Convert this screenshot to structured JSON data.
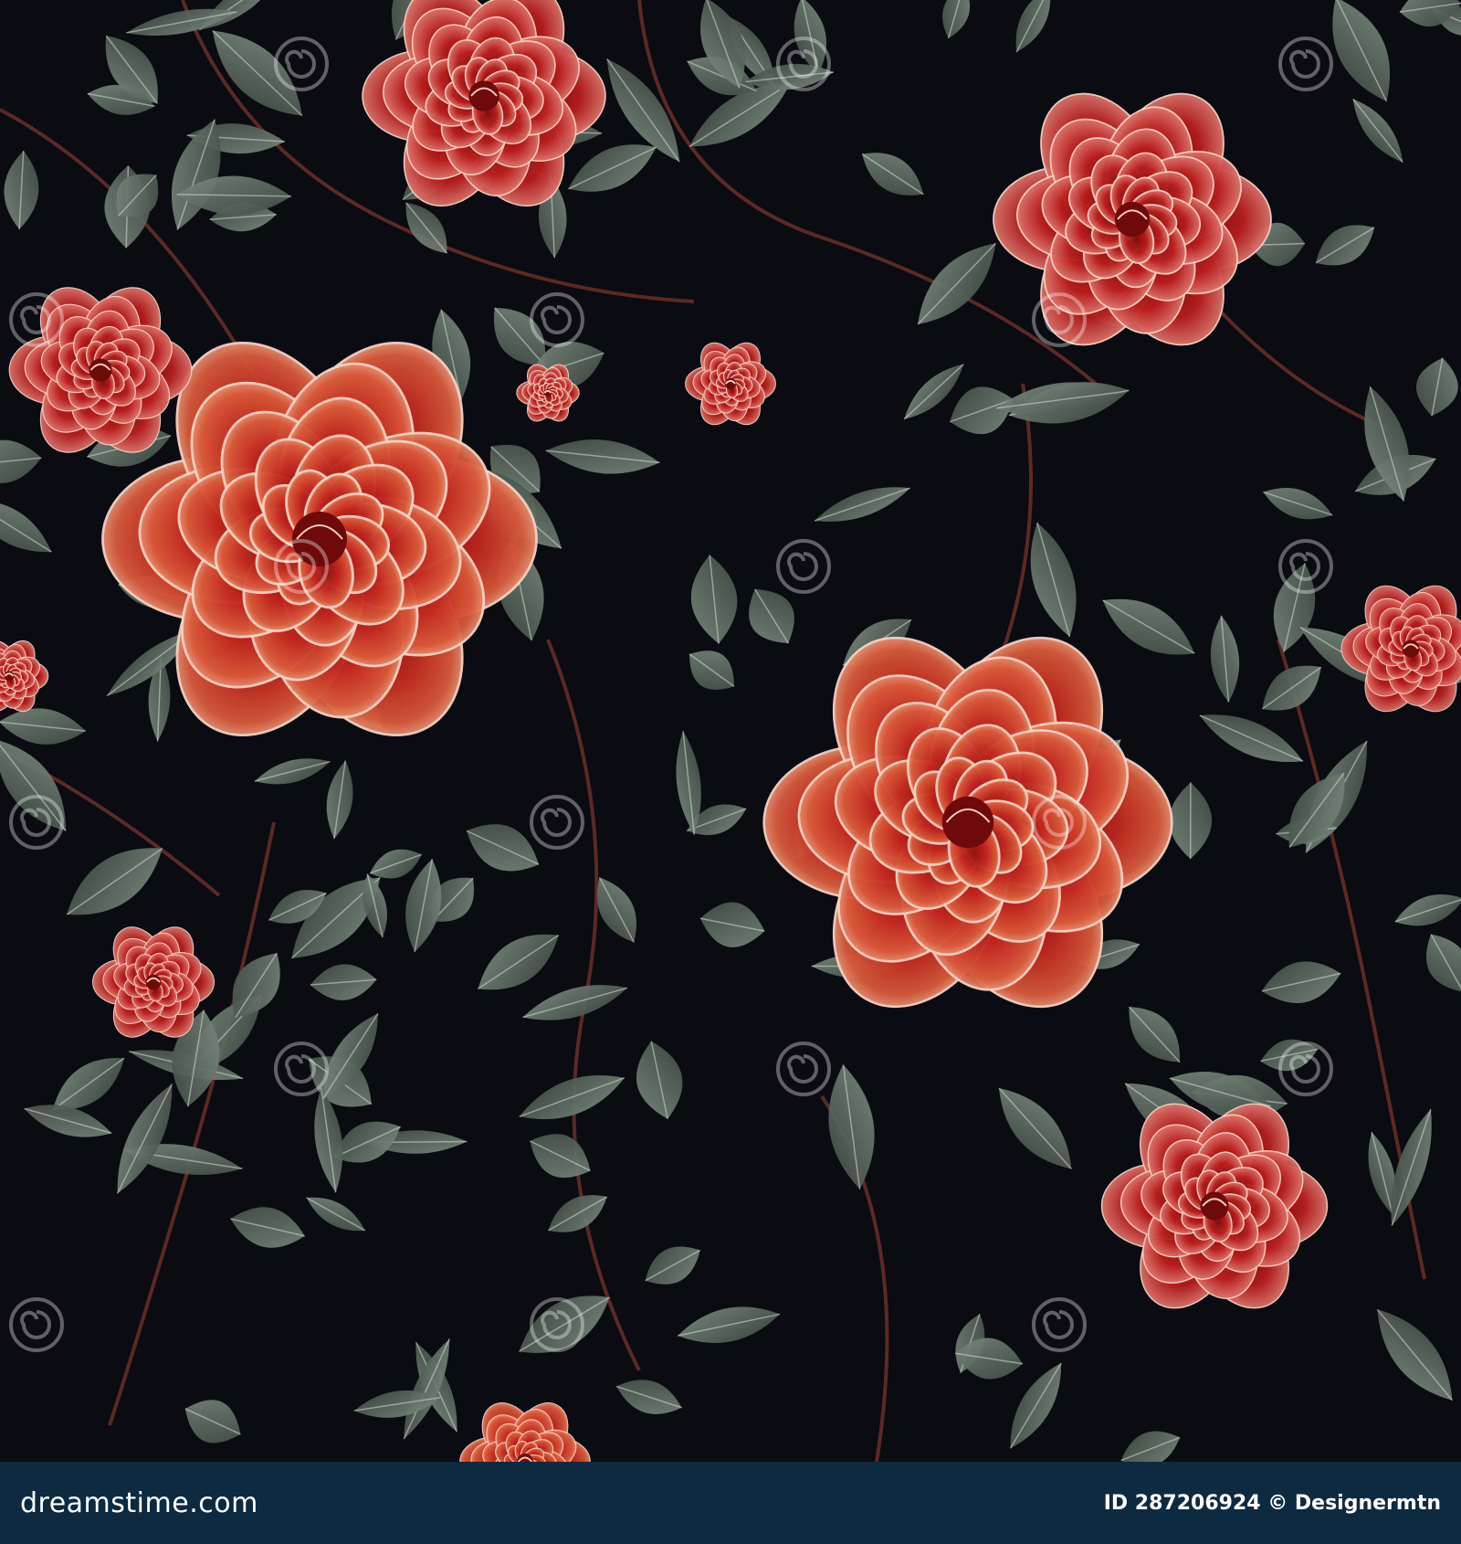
{
  "footer": {
    "logo_text": "dreamstime.com",
    "credit_text": "ID 287206924 © Designermtn"
  },
  "watermark": {
    "text": "dreamstime"
  },
  "colors": {
    "background": "#0b0b12",
    "footer_bar": "#0d2a40",
    "leaf": "#5c6b60",
    "rose_red": "#b3201c",
    "rose_orange": "#d9633a",
    "petal_highlight": "#f2c6b0"
  }
}
